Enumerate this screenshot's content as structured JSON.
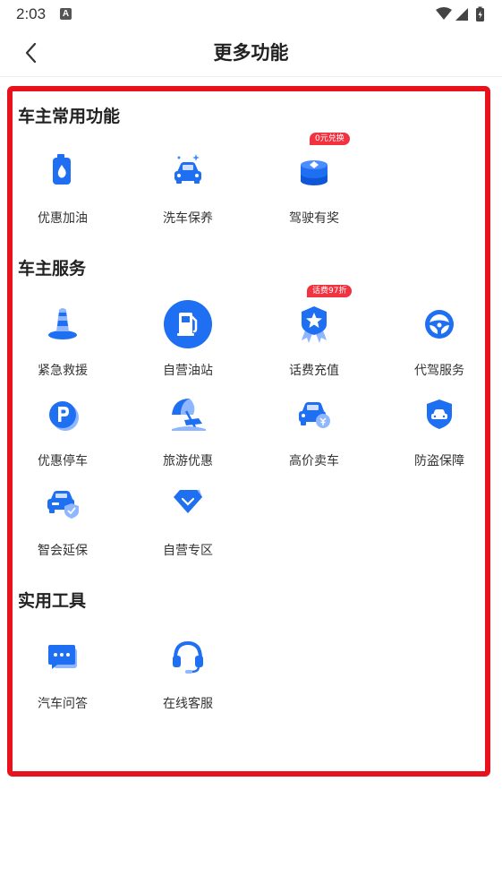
{
  "status_bar": {
    "time": "2:03",
    "notification_letter": "A"
  },
  "header": {
    "title": "更多功能"
  },
  "sections": [
    {
      "title": "车主常用功能",
      "items": [
        {
          "label": "优惠加油",
          "icon": "fuel-drop-icon"
        },
        {
          "label": "洗车保养",
          "icon": "car-wash-icon"
        },
        {
          "label": "驾驶有奖",
          "icon": "coin-stack-icon",
          "badge": "0元兑换"
        }
      ]
    },
    {
      "title": "车主服务",
      "items": [
        {
          "label": "紧急救援",
          "icon": "traffic-cone-icon"
        },
        {
          "label": "自营油站",
          "icon": "gas-pump-icon"
        },
        {
          "label": "话费充值",
          "icon": "star-medal-icon",
          "badge": "话费97折"
        },
        {
          "label": "代驾服务",
          "icon": "steering-wheel-icon"
        },
        {
          "label": "优惠停车",
          "icon": "parking-icon"
        },
        {
          "label": "旅游优惠",
          "icon": "beach-umbrella-icon"
        },
        {
          "label": "高价卖车",
          "icon": "car-sell-icon"
        },
        {
          "label": "防盗保障",
          "icon": "car-shield-icon"
        },
        {
          "label": "智会延保",
          "icon": "car-warranty-icon"
        },
        {
          "label": "自营专区",
          "icon": "diamond-icon"
        }
      ]
    },
    {
      "title": "实用工具",
      "items": [
        {
          "label": "汽车问答",
          "icon": "chat-bubble-icon"
        },
        {
          "label": "在线客服",
          "icon": "headset-icon"
        }
      ]
    }
  ],
  "colors": {
    "accent": "#1f6ff2",
    "highlight_border": "#e8121d",
    "badge": "#f03241"
  }
}
